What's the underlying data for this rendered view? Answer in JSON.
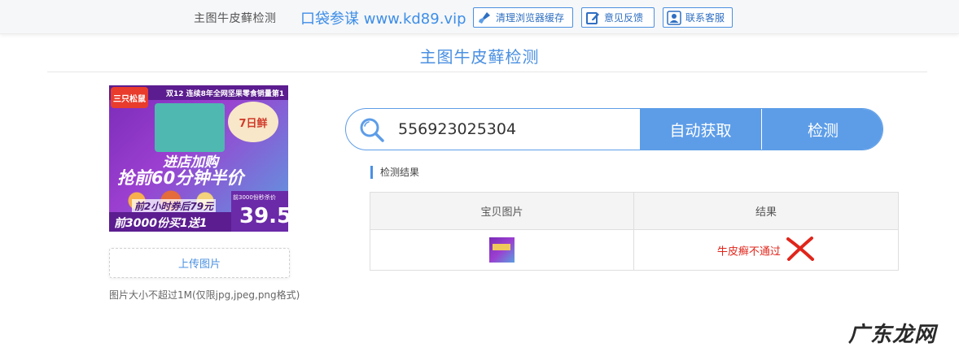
{
  "topbar": {
    "title": "主图牛皮藓检测",
    "brand": "口袋参谋 www.kd89.vip",
    "buttons": [
      {
        "label": "清理浏览器缓存",
        "icon": "broom-icon"
      },
      {
        "label": "意见反馈",
        "icon": "edit-icon"
      },
      {
        "label": "联系客服",
        "icon": "user-icon"
      }
    ]
  },
  "page": {
    "title": "主图牛皮藓检测"
  },
  "product_image": {
    "top_band": "双12 连续8年全网坚果零食销量第1",
    "logo": "三只松鼠",
    "badge": "7日鲜",
    "slogan_line1": "进店加购",
    "slogan_line2": "抢前60分钟半价",
    "coupon": "前2小时券后79元",
    "bottom_text": "前3000份买1送1",
    "price_tag": "前3000份秒杀价",
    "price": "39.5"
  },
  "upload": {
    "button_label": "上传图片",
    "hint": "图片大小不超过1M(仅限jpg,jpeg,png格式)"
  },
  "search": {
    "value": "556923025304",
    "auto_fetch_label": "自动获取",
    "check_label": "检测"
  },
  "results": {
    "section_label": "检测结果",
    "columns": [
      "宝贝图片",
      "结果"
    ],
    "rows": [
      {
        "result_text": "牛皮癣不通过",
        "status": "fail"
      }
    ]
  },
  "watermark": "广东龙网",
  "colors": {
    "accent": "#4a90e2",
    "button_blue": "#5d9de8",
    "fail_red": "#e0251b"
  }
}
